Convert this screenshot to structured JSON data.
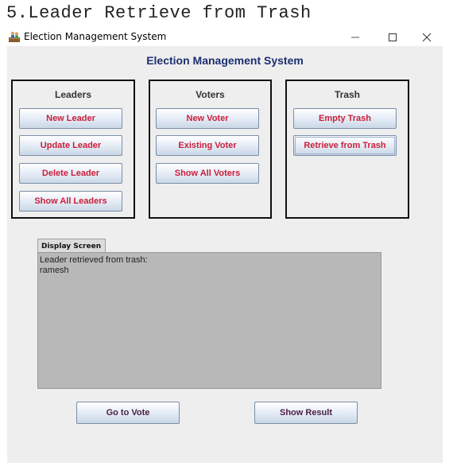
{
  "caption": "5.Leader Retrieve from Trash",
  "window": {
    "title": "Election Management System",
    "controls": {
      "minimize": "—",
      "maximize": "☐",
      "close": "✕"
    }
  },
  "app_title": "Election Management System",
  "panels": {
    "leaders": {
      "title": "Leaders",
      "buttons": [
        "New Leader",
        "Update Leader",
        "Delete Leader",
        "Show All Leaders"
      ]
    },
    "voters": {
      "title": "Voters",
      "buttons": [
        "New Voter",
        "Existing Voter",
        "Show All Voters"
      ]
    },
    "trash": {
      "title": "Trash",
      "buttons": [
        "Empty Trash",
        "Retrieve from Trash"
      ]
    }
  },
  "display": {
    "tab_label": "Display Screen",
    "lines": [
      "Leader retrieved from trash:",
      "ramesh"
    ]
  },
  "bottom_buttons": {
    "vote": "Go to Vote",
    "result": "Show Result"
  },
  "colors": {
    "app_title": "#1c2e6f",
    "button_text": "#cc1e3a",
    "bottom_button_text": "#4b2046",
    "display_bg": "#b8b8b8",
    "window_bg": "#eeeeee"
  }
}
